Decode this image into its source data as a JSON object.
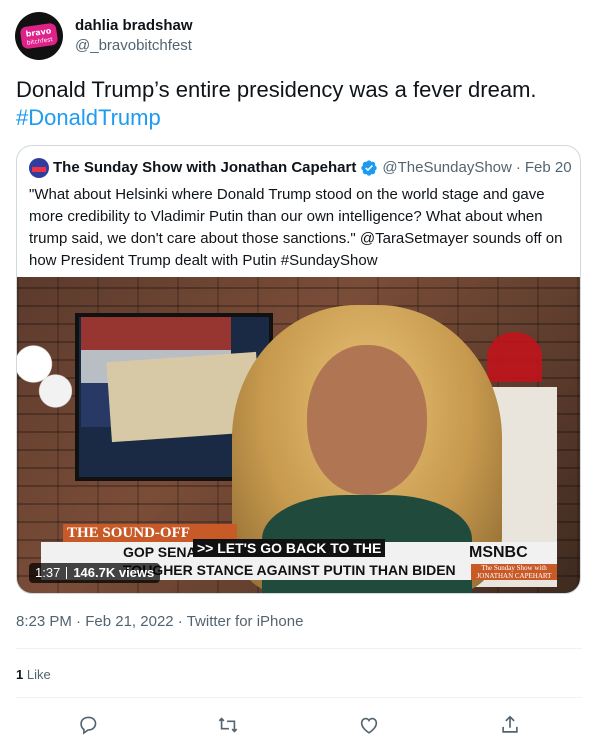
{
  "tweet": {
    "display_name": "dahlia bradshaw",
    "handle": "@_bravobitchfest",
    "avatar_text": "bravo bitchfest",
    "text": "Donald Trump’s entire presidency was a fever dream.",
    "hashtag": "#DonaldTrump",
    "time": "8:23 PM",
    "date": "Feb 21, 2022",
    "source": "Twitter for iPhone",
    "like_count": "1",
    "like_label": "Like"
  },
  "quote": {
    "display_name": "The Sunday Show with Jonathan Capehart",
    "handle": "@TheSundayShow",
    "date": "Feb 20",
    "text": "\"What about Helsinki where Donald Trump stood on the world stage and gave more credibility to Vladimir Putin than our own intelligence? What about when trump said, we don't care about those sanctions.\" @TaraSetmayer sounds off on how President Trump dealt with Putin #SundayShow"
  },
  "video": {
    "duration": "1:37",
    "views": "146.7K views",
    "banner_tab": "THE SOUND-OFF",
    "headline_1": "GOP SENATOR CLAIMS TRUMP TOOK",
    "headline_2": "TOUGHER STANCE AGAINST PUTIN THAN BIDEN",
    "caption": ">> LET'S GO BACK TO THE",
    "network": "MSNBC",
    "show_bug_1": "The Sunday Show with",
    "show_bug_2": "JONATHAN CAPEHART"
  },
  "colors": {
    "accent": "#1d9bf0",
    "muted": "#536471",
    "border": "#cfd9de"
  },
  "icons": [
    "reply-icon",
    "retweet-icon",
    "like-icon",
    "share-icon",
    "verified-icon"
  ]
}
